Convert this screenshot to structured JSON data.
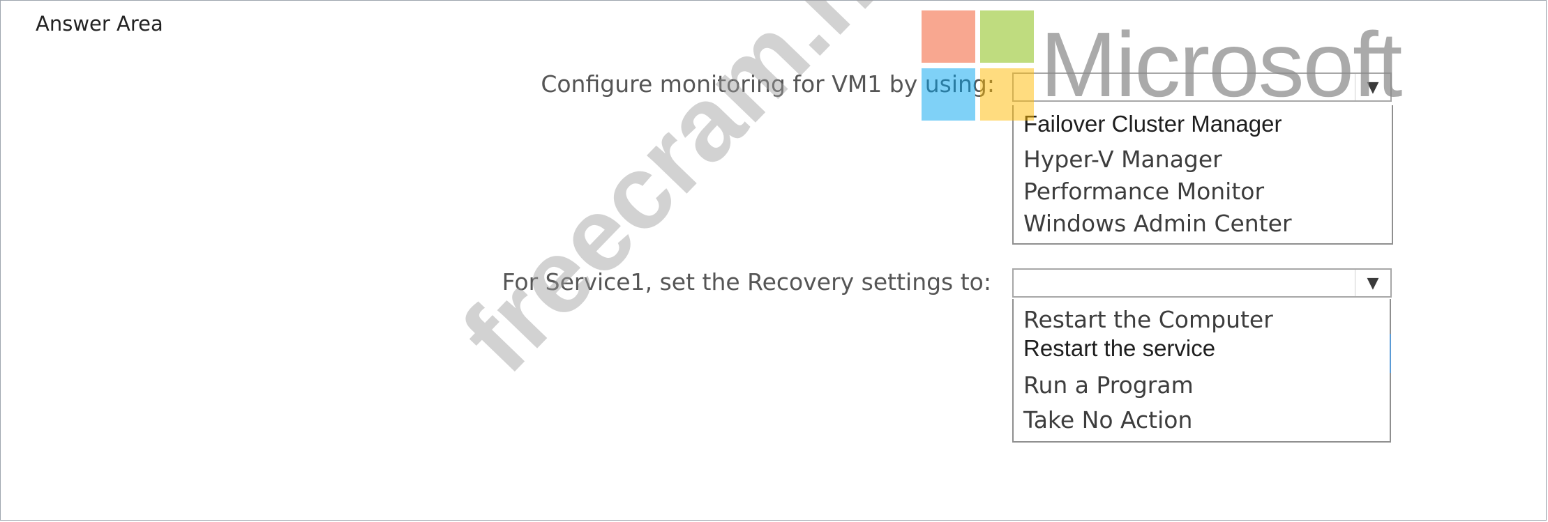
{
  "answer_area": {
    "title": "Answer Area"
  },
  "question1": {
    "prompt": "Configure monitoring for VM1 by using:",
    "selected": "",
    "options": [
      "Failover Cluster Manager",
      "Hyper-V Manager",
      "Performance Monitor",
      "Windows Admin Center"
    ]
  },
  "question2": {
    "prompt": "For Service1, set the Recovery settings to:",
    "selected": "",
    "options": [
      "Restart the Computer",
      "Restart the service",
      "Run a Program",
      "Take No Action"
    ]
  },
  "logo": {
    "text": "Microsoft"
  },
  "watermark": {
    "text": "freecram.net"
  },
  "icons": {
    "dropdown": "chevron-down-icon"
  }
}
